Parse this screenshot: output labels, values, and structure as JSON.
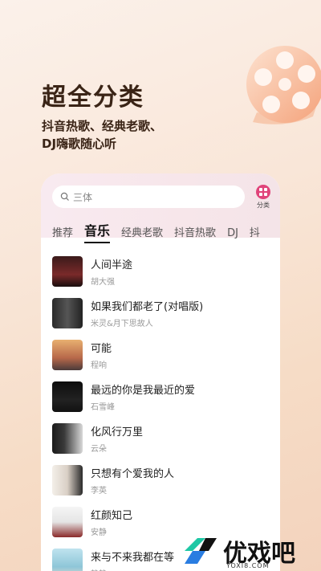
{
  "hero": {
    "headline": "超全分类",
    "subline1": "抖音热歌、经典老歌、",
    "subline2": "DJ嗨歌随心听"
  },
  "search": {
    "value": "三体"
  },
  "category_button": {
    "label": "分类"
  },
  "tabs": [
    "推荐",
    "音乐",
    "经典老歌",
    "抖音热歌",
    "DJ",
    "抖"
  ],
  "songs": [
    {
      "title": "人间半途",
      "artist": "胡大强"
    },
    {
      "title": "如果我们都老了(对唱版)",
      "artist": "米灵&月下思故人"
    },
    {
      "title": "可能",
      "artist": "程响"
    },
    {
      "title": "最远的你是我最近的爱",
      "artist": "石雪峰"
    },
    {
      "title": "化风行万里",
      "artist": "云朵"
    },
    {
      "title": "只想有个爱我的人",
      "artist": "李英"
    },
    {
      "title": "红颜知己",
      "artist": "安静"
    },
    {
      "title": "来与不来我都在等",
      "artist": "静静"
    }
  ],
  "watermark": {
    "text": "优戏吧",
    "url": "YOXI8.COM"
  }
}
